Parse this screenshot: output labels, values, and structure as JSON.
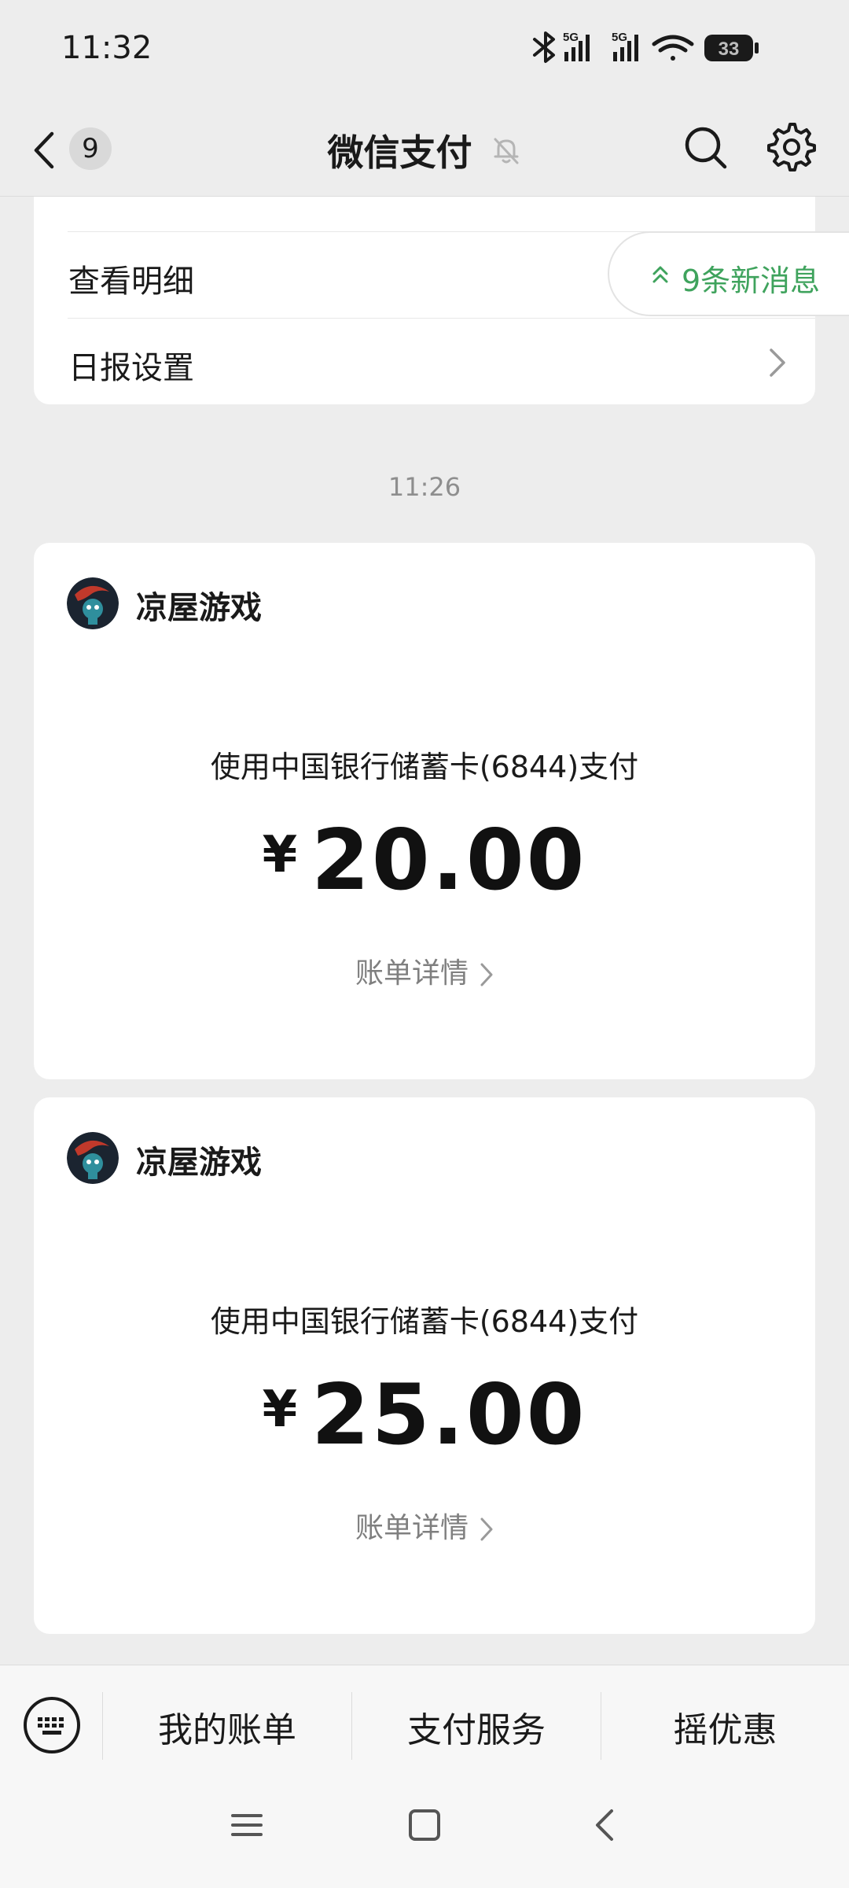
{
  "status_bar": {
    "time": "11:32",
    "battery": "33",
    "signal_label_1": "5G",
    "signal_label_2": "5G"
  },
  "nav": {
    "back_count": "9",
    "title": "微信支付"
  },
  "top_card": {
    "items": [
      {
        "label": "查看明细"
      },
      {
        "label": "日报设置"
      }
    ]
  },
  "new_message_pill": {
    "text": "9条新消息"
  },
  "timestamp": "11:26",
  "payments": [
    {
      "merchant": "凉屋游戏",
      "method": "使用中国银行储蓄卡(6844)支付",
      "currency": "¥",
      "amount": "20.00",
      "detail_label": "账单详情"
    },
    {
      "merchant": "凉屋游戏",
      "method": "使用中国银行储蓄卡(6844)支付",
      "currency": "¥",
      "amount": "25.00",
      "detail_label": "账单详情"
    }
  ],
  "bottom_menu": {
    "items": [
      {
        "label": "我的账单"
      },
      {
        "label": "支付服务"
      },
      {
        "label": "摇优惠"
      }
    ]
  },
  "colors": {
    "background": "#ededed",
    "card": "#ffffff",
    "accent_green": "#3fa35d",
    "secondary_text": "#7f7f7f"
  },
  "icons": [
    "bluetooth-icon",
    "signal-icon",
    "wifi-icon",
    "battery-icon",
    "back-chevron-icon",
    "mute-bell-icon",
    "search-icon",
    "gear-icon",
    "chevron-right-icon",
    "double-chevron-up-icon",
    "keyboard-icon",
    "menu-icon",
    "home-icon",
    "back-icon"
  ]
}
